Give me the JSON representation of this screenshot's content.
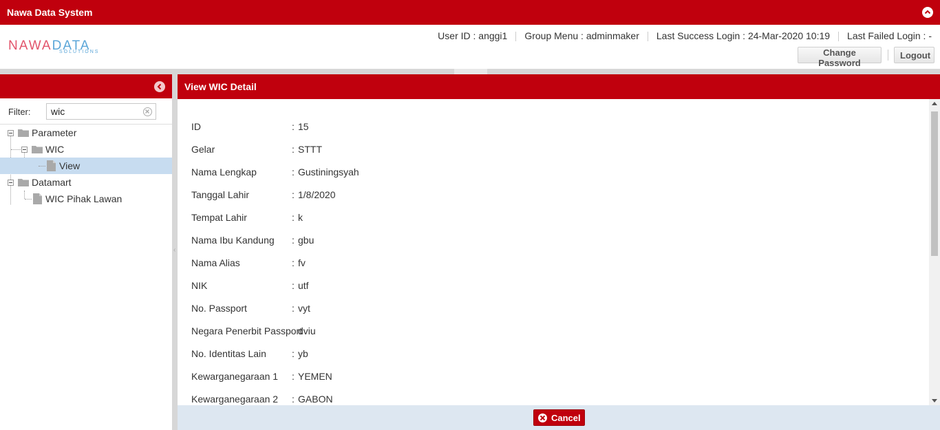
{
  "app": {
    "title": "Nawa Data System"
  },
  "logo": {
    "text_a": "NAWA",
    "text_b": "DATA",
    "sub": "SOLUTIONS"
  },
  "user": {
    "user_id": "User ID : anggi1",
    "group_menu": "Group Menu : adminmaker",
    "last_success": "Last Success Login : 24-Mar-2020 10:19",
    "last_failed": "Last Failed Login : -"
  },
  "buttons": {
    "change_password": "Change Password",
    "logout": "Logout",
    "cancel": "Cancel"
  },
  "filter": {
    "label": "Filter:",
    "value": "wic"
  },
  "tree": {
    "parameter": "Parameter",
    "wic": "WIC",
    "view": "View",
    "datamart": "Datamart",
    "wic_pihak_lawan": "WIC Pihak Lawan"
  },
  "detail": {
    "title": "View WIC Detail",
    "fields": [
      {
        "label": "ID",
        "sep": ":",
        "value": "15"
      },
      {
        "label": "Gelar",
        "sep": ":",
        "value": "STTT"
      },
      {
        "label": "Nama Lengkap",
        "sep": ":",
        "value": "Gustiningsyah"
      },
      {
        "label": "Tanggal Lahir",
        "sep": ":",
        "value": "1/8/2020"
      },
      {
        "label": "Tempat Lahir",
        "sep": ":",
        "value": "k"
      },
      {
        "label": "Nama Ibu Kandung",
        "sep": ":",
        "value": "gbu"
      },
      {
        "label": "Nama Alias",
        "sep": ":",
        "value": "fv"
      },
      {
        "label": "NIK",
        "sep": ":",
        "value": "utf"
      },
      {
        "label": "No. Passport",
        "sep": ":",
        "value": "vyt"
      },
      {
        "label": "Negara Penerbit Passport",
        "sep": "",
        "value": "dviu"
      },
      {
        "label": "No. Identitas Lain",
        "sep": ":",
        "value": "yb"
      },
      {
        "label": "Kewarganegaraan 1",
        "sep": ":",
        "value": "YEMEN"
      },
      {
        "label": "Kewarganegaraan 2",
        "sep": ":",
        "value": "GABON"
      }
    ]
  },
  "colors": {
    "brand_red": "#c0000d",
    "selected_row": "#c7dcf0",
    "footer_bg": "#dde7f1"
  }
}
